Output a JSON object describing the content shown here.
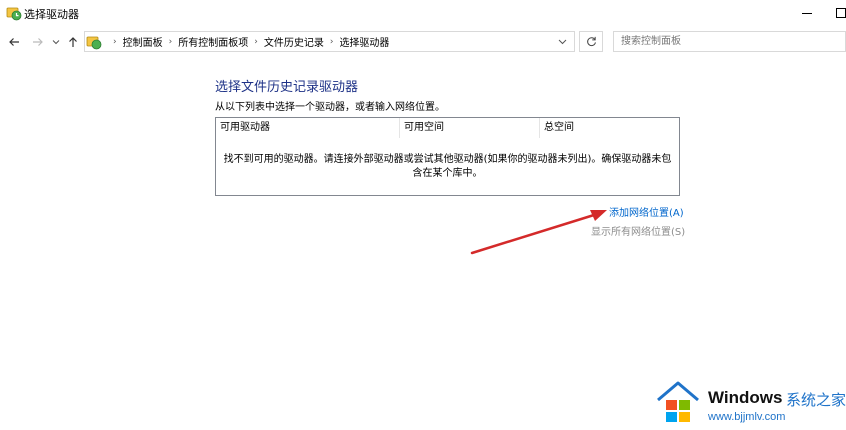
{
  "window": {
    "title": "选择驱动器",
    "icon": "file-history-icon",
    "buttons": {
      "minimize": "minimize-icon",
      "maximize": "maximize-icon"
    }
  },
  "nav": {
    "back_icon": "arrow-left-icon",
    "forward_icon": "arrow-right-icon",
    "recent_icon": "chevron-down-icon",
    "up_icon": "arrow-up-icon",
    "breadcrumbs": [
      "控制面板",
      "所有控制面板项",
      "文件历史记录",
      "选择驱动器"
    ],
    "dropdown_icon": "chevron-down-icon",
    "refresh_icon": "refresh-icon",
    "search_placeholder": "搜索控制面板"
  },
  "main": {
    "heading": "选择文件历史记录驱动器",
    "instruction": "从以下列表中选择一个驱动器，或者输入网络位置。",
    "columns": [
      "可用驱动器",
      "可用空间",
      "总空间"
    ],
    "empty_message": "找不到可用的驱动器。请连接外部驱动器或尝试其他驱动器(如果你的驱动器未列出)。确保驱动器未包含在某个库中。",
    "add_network_link": "添加网络位置(A)",
    "show_network_link": "显示所有网络位置(S)"
  },
  "annotation": {
    "arrow_color": "#d42a2a"
  },
  "watermark": {
    "brand": "Windows",
    "chinese": "系统之家",
    "url": "www.bjjmlv.com"
  },
  "colors": {
    "heading": "#1e3287",
    "link": "#0066cc",
    "disabled_link": "#8d8d8d",
    "watermark_blue": "#1f73c9"
  }
}
